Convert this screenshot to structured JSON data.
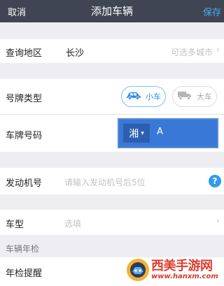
{
  "nav": {
    "cancel": "取消",
    "title": "添加车辆",
    "save": "保存"
  },
  "region": {
    "label": "查询地区",
    "value": "长沙",
    "hint": "可选多城市",
    "chevron": "›"
  },
  "plate_type": {
    "label": "号牌类型",
    "options": [
      {
        "label": "小车",
        "icon": "car-icon",
        "selected": true
      },
      {
        "label": "大车",
        "icon": "truck-icon",
        "selected": false
      }
    ]
  },
  "plate_number": {
    "label": "车牌号码",
    "province": "湘",
    "caret": "▾",
    "value": "A"
  },
  "engine": {
    "label": "发动机号",
    "placeholder": "请输入发动机号后5位",
    "help": "?"
  },
  "model": {
    "label": "车型",
    "placeholder": "选填",
    "chevron": "›"
  },
  "inspection_section": {
    "title": "车辆年检"
  },
  "inspection_reminder": {
    "label": "年检提醒"
  },
  "watermark": {
    "text": "西美手游网",
    "url": "www.hanxm.com"
  },
  "colors": {
    "navbar": "#3f4552",
    "accent": "#2d8fe5",
    "plate_bg": "#3a78d8",
    "watermark": "#e13b2f"
  }
}
